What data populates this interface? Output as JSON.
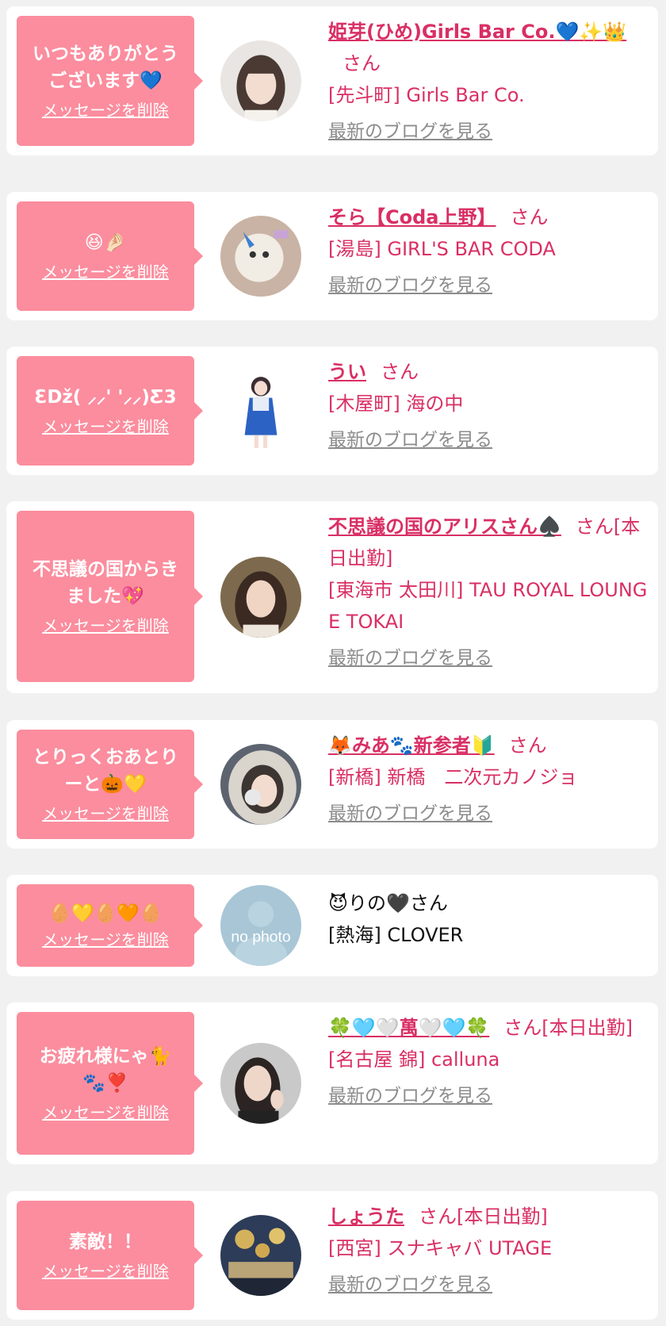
{
  "colors": {
    "accent": "#d92f64",
    "bubble": "#fb8d9e",
    "muted": "#8c8c8c",
    "background": "#f1f1f1"
  },
  "common": {
    "delete_label": "メッセージを削除",
    "blog_label": "最新のブログを見る",
    "honorific": "さん"
  },
  "items": [
    {
      "message": "いつもありがとうございます💙",
      "name": "姫芽(ひめ)Girls Bar Co.💙✨👑",
      "suffix": "さん",
      "shop": "[先斗町] Girls Bar Co.",
      "avatar": "girl-portrait"
    },
    {
      "message": "😆🤌🏻",
      "name": "そら【Coda上野】",
      "suffix": "さん",
      "shop": "[湯島] GIRL'S BAR CODA",
      "avatar": "plush-toy-photo"
    },
    {
      "message": "ƐDž( ⸝⸝' '⸝⸝)Ƹ3",
      "name": "うい",
      "suffix": "さん",
      "shop": "[木屋町] 海の中",
      "avatar": "idol-costume-photo"
    },
    {
      "message": "不思議の国からきました💖",
      "name": "不思議の国のアリスさん♠️",
      "suffix": "さん[本日出勤]",
      "shop": "[東海市 太田川] TAU ROYAL LOUNGE TOKAI",
      "avatar": "girl-portrait"
    },
    {
      "message": "とりっくおあとりーと🎃💛",
      "name": "🦊みあ🐾新参者🔰",
      "suffix": "さん",
      "shop": "[新橋] 新橋　二次元カノジョ",
      "avatar": "fur-hood-photo"
    },
    {
      "message": "🥚💛🥚🧡🥚",
      "name": "😈りの🖤さん",
      "suffix": "",
      "shop": "[熱海] CLOVER",
      "avatar": "no-photo"
    },
    {
      "message": "お疲れ様にゃ🐈🐾❣️",
      "name": "🍀🩵🤍萬🤍🩵🍀",
      "suffix": "さん[本日出勤]",
      "shop": "[名古屋 錦] calluna",
      "avatar": "girl-portrait"
    },
    {
      "message": "素敵！！",
      "name": "しょうた",
      "suffix": "さん[本日出勤]",
      "shop": "[西宮] スナキャバ UTAGE",
      "avatar": "party-photo"
    }
  ],
  "no_photo_text": "no photo"
}
